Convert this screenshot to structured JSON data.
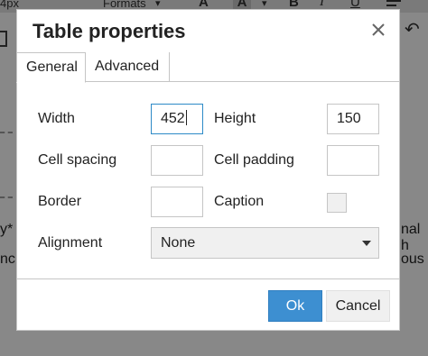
{
  "background": {
    "toolbar_left_text": "4px",
    "toolbar_formats": "Formats",
    "toolbar_a1": "A",
    "toolbar_a2": "A",
    "toolbar_bold": "B",
    "toolbar_italic": "I",
    "toolbar_underline": "U",
    "text_left_1": "y*",
    "text_left_2": "nc",
    "text_right_1": "nal h",
    "text_right_2": "ous"
  },
  "dialog": {
    "title": "Table properties",
    "tabs": [
      {
        "label": "General",
        "active": true
      },
      {
        "label": "Advanced",
        "active": false
      }
    ],
    "fields": {
      "width": {
        "label": "Width",
        "value": "452"
      },
      "height": {
        "label": "Height",
        "value": "150"
      },
      "cell_spacing": {
        "label": "Cell spacing",
        "value": ""
      },
      "cell_padding": {
        "label": "Cell padding",
        "value": ""
      },
      "border": {
        "label": "Border",
        "value": ""
      },
      "caption": {
        "label": "Caption",
        "checked": false
      },
      "alignment": {
        "label": "Alignment",
        "selected": "None"
      }
    },
    "buttons": {
      "ok": "Ok",
      "cancel": "Cancel"
    }
  },
  "colors": {
    "accent": "#3d8fd1",
    "focus_border": "#2d8ac7",
    "overlay": "#888888"
  }
}
